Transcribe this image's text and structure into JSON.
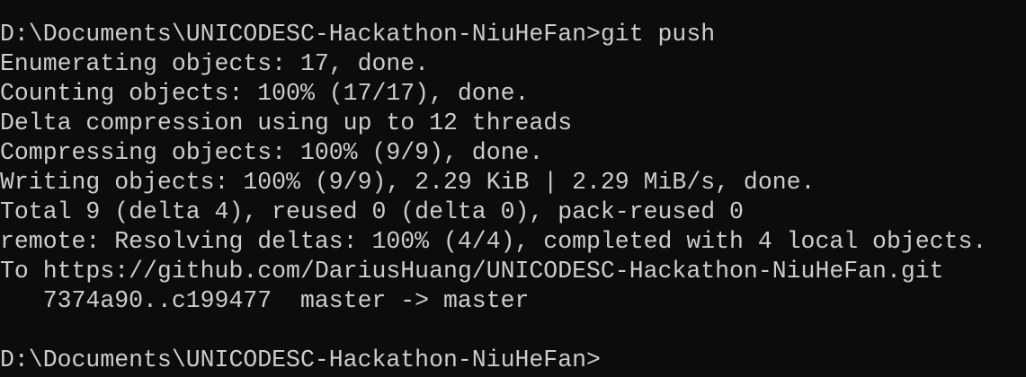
{
  "terminal": {
    "lines": [
      "D:\\Documents\\UNICODESC-Hackathon-NiuHeFan>git push",
      "Enumerating objects: 17, done.",
      "Counting objects: 100% (17/17), done.",
      "Delta compression using up to 12 threads",
      "Compressing objects: 100% (9/9), done.",
      "Writing objects: 100% (9/9), 2.29 KiB | 2.29 MiB/s, done.",
      "Total 9 (delta 4), reused 0 (delta 0), pack-reused 0",
      "remote: Resolving deltas: 100% (4/4), completed with 4 local objects.",
      "To https://github.com/DariusHuang/UNICODESC-Hackathon-NiuHeFan.git",
      "   7374a90..c199477  master -> master",
      "",
      "D:\\Documents\\UNICODESC-Hackathon-NiuHeFan>"
    ],
    "colors": {
      "background": "#0c0c0c",
      "foreground": "#cccccc"
    }
  }
}
